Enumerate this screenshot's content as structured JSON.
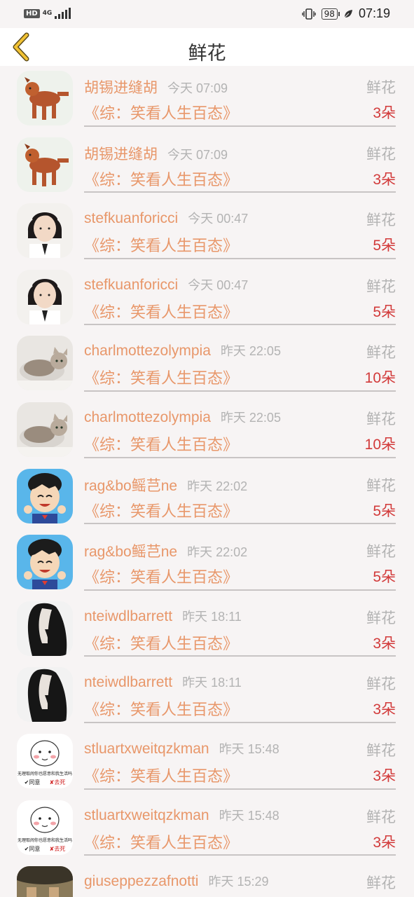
{
  "status": {
    "hd": "HD",
    "network": "4G",
    "battery": "98",
    "time": "07:19"
  },
  "nav": {
    "title": "鲜花",
    "back_icon": "chevron-left-icon"
  },
  "colors": {
    "name": "#e8976a",
    "count": "#d23a3a",
    "muted": "#b3b3b3"
  },
  "items": [
    {
      "avatar": "dog",
      "name": "胡锡进缝胡",
      "time": "今天 07:09",
      "kind": "鲜花",
      "book": "《综：笑看人生百态》",
      "count": "3朵"
    },
    {
      "avatar": "dog",
      "name": "胡锡进缝胡",
      "time": "今天 07:09",
      "kind": "鲜花",
      "book": "《综：笑看人生百态》",
      "count": "3朵"
    },
    {
      "avatar": "girl",
      "name": "stefkuanforicci",
      "time": "今天 00:47",
      "kind": "鲜花",
      "book": "《综：笑看人生百态》",
      "count": "5朵"
    },
    {
      "avatar": "girl",
      "name": "stefkuanforicci",
      "time": "今天 00:47",
      "kind": "鲜花",
      "book": "《综：笑看人生百态》",
      "count": "5朵"
    },
    {
      "avatar": "cat",
      "name": "charlmottezolympia",
      "time": "昨天 22:05",
      "kind": "鲜花",
      "book": "《综：笑看人生百态》",
      "count": "10朵"
    },
    {
      "avatar": "cat",
      "name": "charlmottezolympia",
      "time": "昨天 22:05",
      "kind": "鲜花",
      "book": "《综：笑看人生百态》",
      "count": "10朵"
    },
    {
      "avatar": "cartoon",
      "name": "rag&bo鳐芑ne",
      "time": "昨天 22:02",
      "kind": "鲜花",
      "book": "《综：笑看人生百态》",
      "count": "5朵"
    },
    {
      "avatar": "cartoon",
      "name": "rag&bo鳐芑ne",
      "time": "昨天 22:02",
      "kind": "鲜花",
      "book": "《综：笑看人生百态》",
      "count": "5朵"
    },
    {
      "avatar": "hair",
      "name": "nteiwdlbarrett",
      "time": "昨天 18:11",
      "kind": "鲜花",
      "book": "《综：笑看人生百态》",
      "count": "3朵"
    },
    {
      "avatar": "hair",
      "name": "nteiwdlbarrett",
      "time": "昨天 18:11",
      "kind": "鲜花",
      "book": "《综：笑看人生百态》",
      "count": "3朵"
    },
    {
      "avatar": "meme",
      "name": "stluartxweitqzkman",
      "time": "昨天 15:48",
      "kind": "鲜花",
      "book": "《综：笑看人生百态》",
      "count": "3朵",
      "meme_text": "无理取闹你也愿意和我生活吗",
      "meme_yes": "✔同意",
      "meme_no": "✘去死"
    },
    {
      "avatar": "meme",
      "name": "stluartxweitqzkman",
      "time": "昨天 15:48",
      "kind": "鲜花",
      "book": "《综：笑看人生百态》",
      "count": "3朵",
      "meme_text": "无理取闹你也愿意和我生活吗",
      "meme_yes": "✔同意",
      "meme_no": "✘去死"
    },
    {
      "avatar": "feet",
      "name": "giuseppezzafnotti",
      "time": "昨天 15:29",
      "kind": "鲜花",
      "book": "",
      "count": ""
    }
  ]
}
